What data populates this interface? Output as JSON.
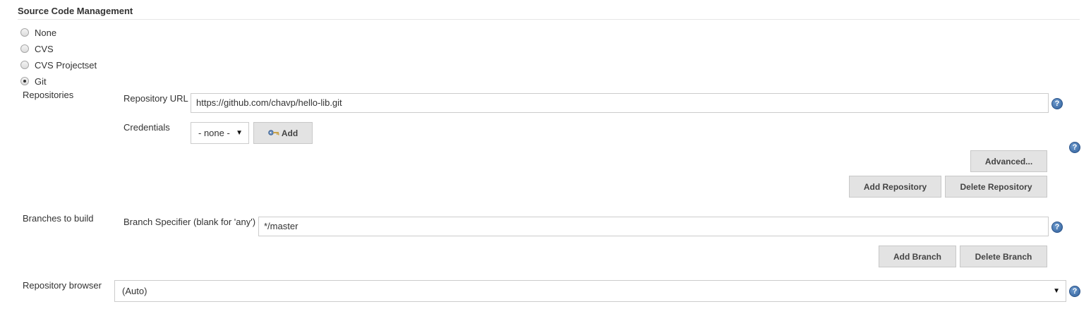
{
  "section": {
    "title": "Source Code Management"
  },
  "scm_options": [
    {
      "label": "None",
      "checked": false
    },
    {
      "label": "CVS",
      "checked": false
    },
    {
      "label": "CVS Projectset",
      "checked": false
    },
    {
      "label": "Git",
      "checked": true
    }
  ],
  "repositories": {
    "label": "Repositories",
    "repo_url_label": "Repository URL",
    "repo_url_value": "https://github.com/chavp/hello-lib.git",
    "credentials_label": "Credentials",
    "credentials_selected": "- none -",
    "add_button": "Add",
    "advanced_button": "Advanced...",
    "add_repository_button": "Add Repository",
    "delete_repository_button": "Delete Repository"
  },
  "branches": {
    "label": "Branches to build",
    "specifier_label": "Branch Specifier (blank for 'any')",
    "specifier_value": "*/master",
    "add_branch_button": "Add Branch",
    "delete_branch_button": "Delete Branch"
  },
  "browser": {
    "label": "Repository browser",
    "selected": "(Auto)"
  },
  "icons": {
    "help": "help-icon",
    "key": "key-icon",
    "dropdown": "chevron-down-icon"
  },
  "colors": {
    "help_blue": "#2f5f9a",
    "button_bg": "#e3e3e3",
    "border": "#cccccc"
  }
}
